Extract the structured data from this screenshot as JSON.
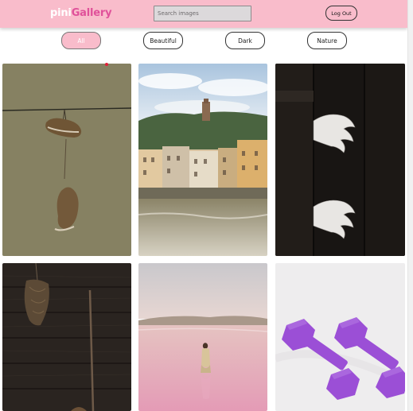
{
  "header": {
    "logo_prefix": "pini",
    "logo_suffix": "Gallery",
    "search_placeholder": "Search images",
    "logout_label": "Log Out"
  },
  "filters": [
    {
      "label": "All",
      "active": true
    },
    {
      "label": "Beautiful",
      "active": false
    },
    {
      "label": "Dark",
      "active": false
    },
    {
      "label": "Nature",
      "active": false
    }
  ],
  "gallery": {
    "images": [
      {
        "subject": "sneakers-on-wire"
      },
      {
        "subject": "florence-riverside"
      },
      {
        "subject": "hands-through-door"
      },
      {
        "subject": "dark-wooden-wall"
      },
      {
        "subject": "woman-in-pink-lake"
      },
      {
        "subject": "purple-dumbbells"
      }
    ]
  },
  "colors": {
    "navbar": "#f9bccb",
    "logo_accent": "#e0509a",
    "dumbbell": "#9b4fd6"
  }
}
